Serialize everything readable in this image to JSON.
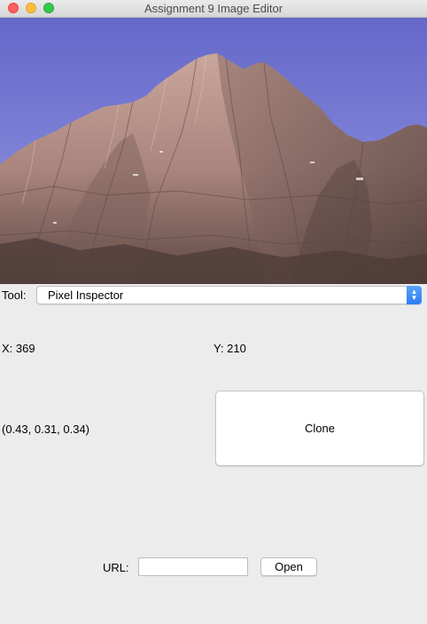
{
  "window": {
    "title": "Assignment 9 Image Editor"
  },
  "image": {
    "subject": "mountain-landscape"
  },
  "tool": {
    "label": "Tool:",
    "selected": "Pixel Inspector"
  },
  "inspector": {
    "x_label": "X: 369",
    "y_label": "Y: 210",
    "color_value": "(0.43, 0.31, 0.34)"
  },
  "buttons": {
    "clone": "Clone",
    "open": "Open"
  },
  "url": {
    "label": "URL:",
    "value": ""
  },
  "colors": {
    "sky_top": "#6a6ecb",
    "sky_bottom": "#8a8fdb",
    "rock_light": "#c8a39a",
    "rock_dark": "#6b524d",
    "select_accent": "#2c7cf2"
  }
}
